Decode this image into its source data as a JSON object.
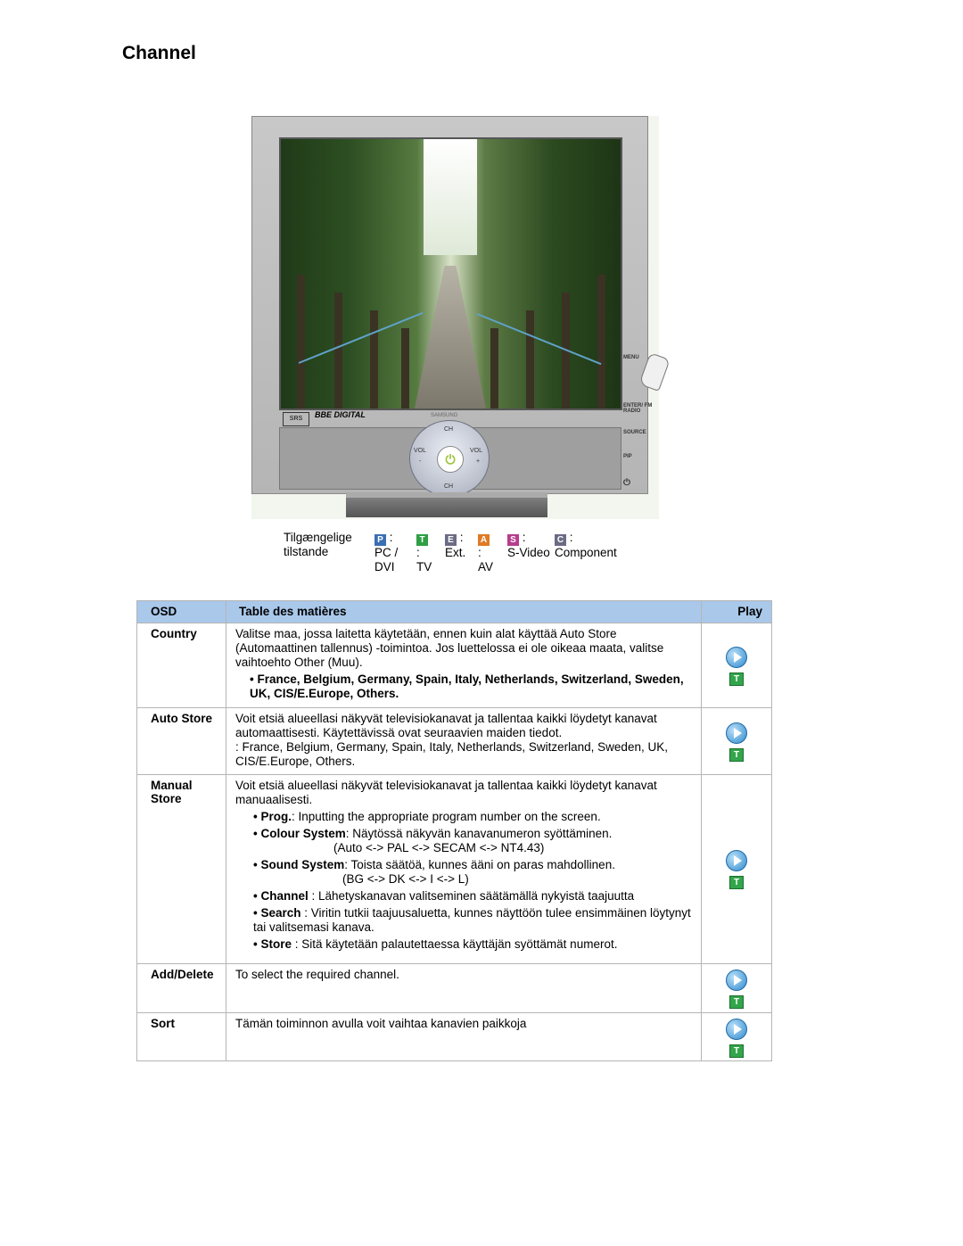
{
  "page": {
    "title": "Channel"
  },
  "monitor": {
    "brand_badge1": "SRS",
    "brand_badge2": "BBE DIGITAL",
    "brand_name": "SAMSUNG",
    "buttons": {
      "ch_up": "CH",
      "ch_down": "CH",
      "vol_left": "VOL",
      "vol_right": "VOL",
      "plus": "+",
      "minus": "-"
    },
    "side_labels": [
      "MENU",
      "ENTER/ FM RADIO",
      "SOURCE",
      "PIP"
    ]
  },
  "modes": {
    "label": "Tilgængelige tilstande",
    "items": [
      {
        "icon": "P",
        "color": "#3b6fb5",
        "name": "PC / DVI"
      },
      {
        "icon": "T",
        "color": "#2f9e44",
        "name": "TV"
      },
      {
        "icon": "E",
        "color": "#6b6b84",
        "name": "Ext."
      },
      {
        "icon": "A",
        "color": "#e07a25",
        "name": "AV"
      },
      {
        "icon": "S",
        "color": "#b73c8e",
        "name": "S-Video"
      },
      {
        "icon": "C",
        "color": "#6b6b84",
        "name": "Component"
      }
    ]
  },
  "table": {
    "headers": {
      "osd": "OSD",
      "contents": "Table des matières",
      "play": "Play"
    },
    "rows": [
      {
        "name": "Country",
        "text": "Valitse maa, jossa laitetta käytetään, ennen kuin alat käyttää Auto Store (Automaattinen tallennus) -toimintoa. Jos luettelossa ei ole oikeaa maata, valitse vaihtoehto Other (Muu).",
        "bold_list": "• France, Belgium, Germany, Spain, Italy, Netherlands, Switzerland, Sweden, UK, CIS/E.Europe, Others."
      },
      {
        "name": "Auto Store",
        "text": "Voit etsiä alueellasi näkyvät televisiokanavat ja tallentaa kaikki löydetyt kanavat automaattisesti. Käytettävissä ovat seuraavien maiden tiedot.",
        "text2": ": France, Belgium, Germany, Spain, Italy, Netherlands, Switzerland, Sweden, UK, CIS/E.Europe, Others."
      },
      {
        "name": "Manual Store",
        "text": "Voit etsiä alueellasi näkyvät televisiokanavat ja tallentaa kaikki löydetyt kanavat manuaalisesti.",
        "items": [
          {
            "b": "• Prog.",
            "t": ": Inputting the appropriate program number on the screen."
          },
          {
            "b": "• Colour System",
            "t": ": Näytössä näkyvän kanavanumeron syöttäminen.",
            "sub": "(Auto <-> PAL <-> SECAM <-> NT4.43)"
          },
          {
            "b": "• Sound System",
            "t": ": Toista säätöä, kunnes ääni on paras mahdollinen.",
            "sub": "(BG <-> DK <-> I <-> L)"
          },
          {
            "b": "• Channel",
            "t": " : Lähetyskanavan valitseminen säätämällä nykyistä taajuutta"
          },
          {
            "b": "• Search",
            "t": " : Viritin tutkii taajuusaluetta, kunnes näyttöön tulee ensimmäinen löytynyt tai valitsemasi kanava."
          },
          {
            "b": "• Store",
            "t": " : Sitä käytetään palautettaessa käyttäjän syöttämät numerot."
          }
        ]
      },
      {
        "name": "Add/Delete",
        "text": "To select the required channel."
      },
      {
        "name": "Sort",
        "text": "Tämän toiminnon avulla voit vaihtaa kanavien paikkoja"
      }
    ],
    "play_icon": "play-button-icon",
    "tv_icon_letter": "T"
  }
}
